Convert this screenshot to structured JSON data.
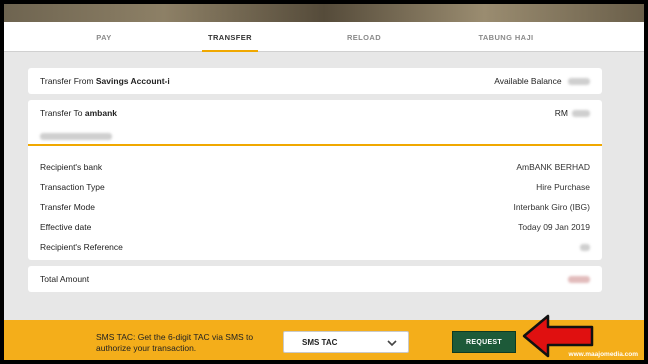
{
  "tabs": [
    {
      "label": "PAY",
      "active": false
    },
    {
      "label": "TRANSFER",
      "active": true
    },
    {
      "label": "RELOAD",
      "active": false
    },
    {
      "label": "TABUNG HAJI",
      "active": false
    }
  ],
  "transfer_from": {
    "prefix": "Transfer From ",
    "account": "Savings Account-i",
    "balance_label": "Available Balance"
  },
  "transfer_to": {
    "prefix": "Transfer To ",
    "bank": "ambank",
    "amount_prefix": "RM"
  },
  "details": [
    {
      "label": "Recipient's bank",
      "value": "AmBANK BERHAD"
    },
    {
      "label": "Transaction Type",
      "value": "Hire Purchase"
    },
    {
      "label": "Transfer Mode",
      "value": "Interbank Giro (IBG)"
    },
    {
      "label": "Effective date",
      "value": "Today 09 Jan 2019"
    },
    {
      "label": "Recipient's Reference",
      "value": ""
    }
  ],
  "total": {
    "label": "Total Amount"
  },
  "footer": {
    "tac_text": "SMS TAC: Get the 6-digit TAC via SMS to authorize your transaction.",
    "select_value": "SMS TAC",
    "request_label": "REQUEST"
  },
  "watermark": "www.maajomedia.com",
  "colors": {
    "accent": "#f0a800",
    "footer_bg": "#f4ae1a",
    "request_button": "#1d5a39",
    "arrow": "#e01010"
  }
}
